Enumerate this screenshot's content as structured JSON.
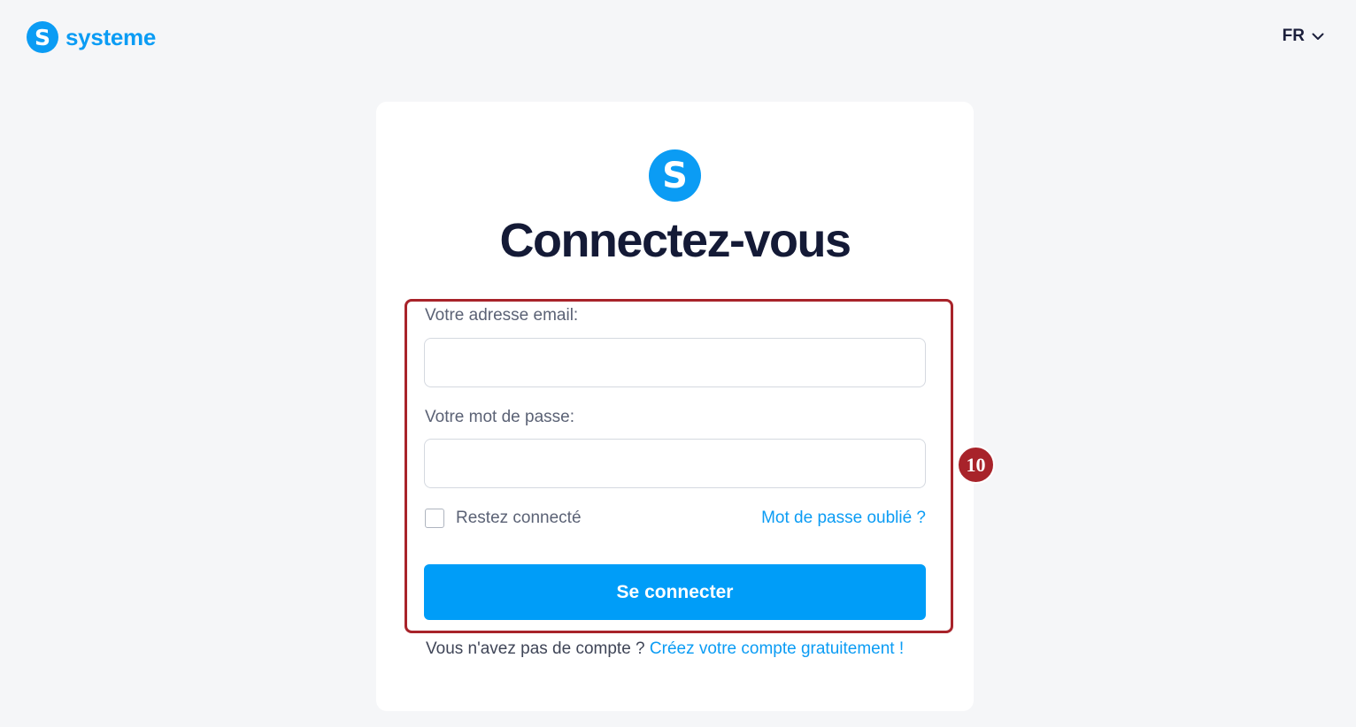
{
  "header": {
    "logo_letter": "S",
    "brand_name": "systeme",
    "language": "FR"
  },
  "card": {
    "logo_letter": "S",
    "title": "Connectez-vous"
  },
  "form": {
    "email_label": "Votre adresse email:",
    "email_value": "",
    "password_label": "Votre mot de passe:",
    "password_value": "",
    "remember_label": "Restez connecté",
    "remember_checked": false,
    "forgot_link": "Mot de passe oublié ?",
    "submit_label": "Se connecter"
  },
  "annotation": {
    "badge_number": "10",
    "highlight_color": "#a8232a"
  },
  "footer": {
    "no_account_text": "Vous n'avez pas de compte ?",
    "signup_link": "Créez votre compte gratuitement !"
  },
  "colors": {
    "brand": "#0b9cf4",
    "button": "#009df8",
    "background": "#f5f6f8"
  }
}
